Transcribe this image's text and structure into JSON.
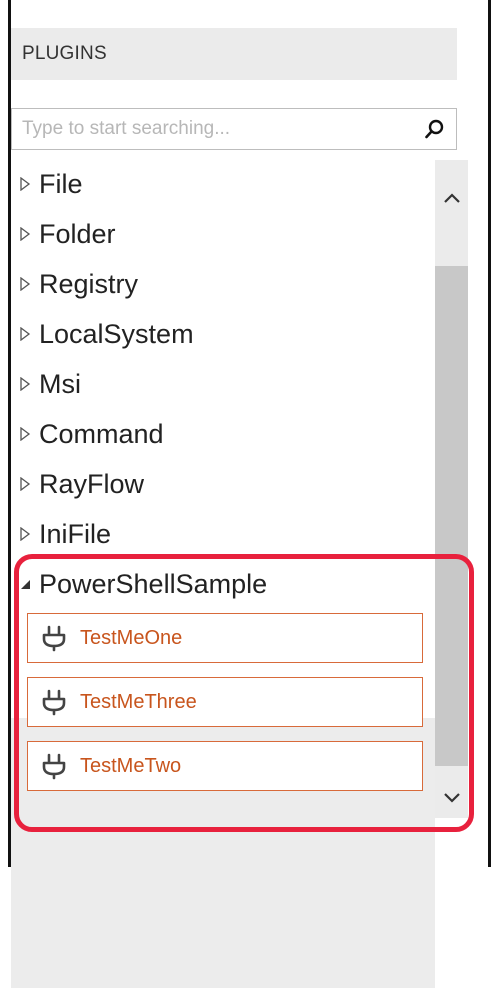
{
  "header": {
    "title": "PLUGINS"
  },
  "search": {
    "placeholder": "Type to start searching..."
  },
  "tree": {
    "items": [
      {
        "label": "File"
      },
      {
        "label": "Folder"
      },
      {
        "label": "Registry"
      },
      {
        "label": "LocalSystem"
      },
      {
        "label": "Msi"
      },
      {
        "label": "Command"
      },
      {
        "label": "RayFlow"
      },
      {
        "label": "IniFile"
      }
    ],
    "expanded_group": {
      "label": "PowerShellSample",
      "plugins": [
        {
          "label": "TestMeOne"
        },
        {
          "label": "TestMeThree"
        },
        {
          "label": "TestMeTwo"
        }
      ]
    }
  },
  "colors": {
    "plugin_text": "#c8551d",
    "plugin_border": "#d86a3a",
    "highlight": "#e8213d"
  },
  "icons": {
    "collapsed": "triangle-right-outline",
    "expanded": "triangle-down-filled",
    "plugin": "plug-icon",
    "search": "magnifier-icon",
    "scroll_up": "chevron-up-icon",
    "scroll_down": "chevron-down-icon"
  }
}
